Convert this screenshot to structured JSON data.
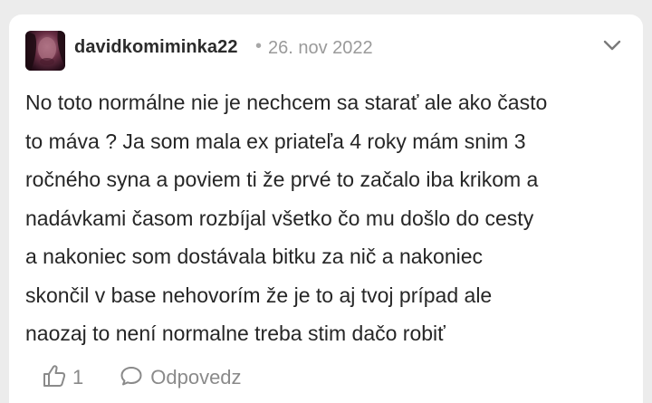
{
  "comment": {
    "username": "davidkomiminka22",
    "separator": "•",
    "date": "26. nov 2022",
    "text": "No toto normálne nie je nechcem sa starať ale ako často\nto máva ? Ja som mala ex priateľa 4 roky mám snim 3\nročného syna a poviem ti že prvé to začalo iba krikom a\nnadávkami časom rozbíjal všetko čo mu došlo do cesty\na nakoniec som dostávala bitku za nič a nakoniec\nskončil v base nehovorím že je to aj tvoj prípad ale\nnaozaj to není normalne treba stim dačo robiť",
    "like_count": "1",
    "reply_label": "Odpovedz"
  },
  "icons": {
    "avatar": "avatar-photo",
    "menu": "chevron-down-icon",
    "like": "thumbs-up-icon",
    "reply": "speech-bubble-icon"
  },
  "colors": {
    "background": "#ececec",
    "card": "#ffffff",
    "text": "#262626",
    "muted": "#8a8a8a"
  }
}
